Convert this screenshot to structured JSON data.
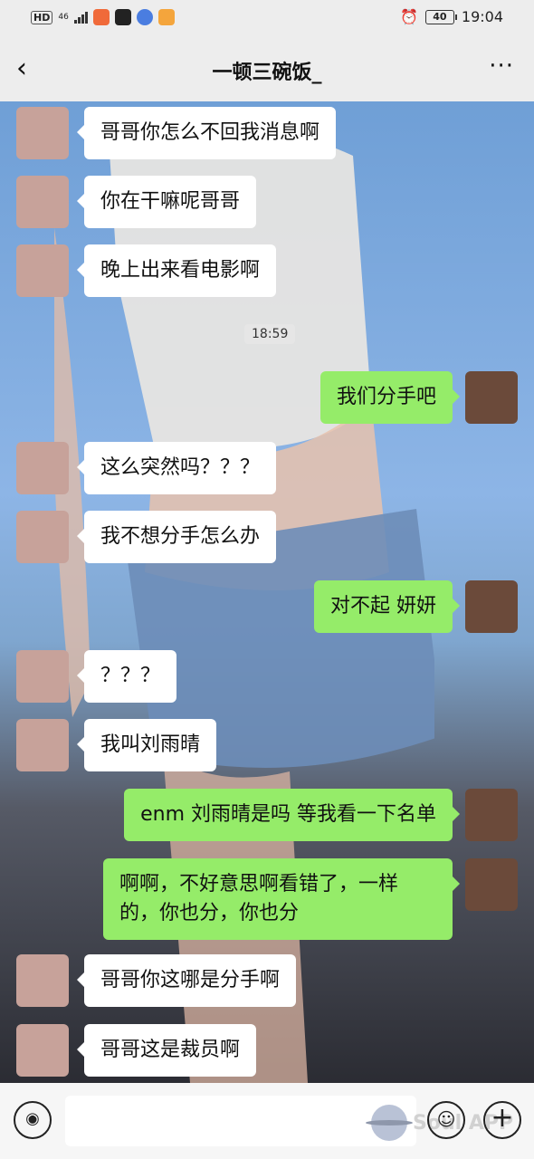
{
  "status_bar": {
    "hd": "HD",
    "network": "46",
    "time": "19:04",
    "battery": "40",
    "icons": [
      "hd-icon",
      "signal-icon",
      "app-badge-icon",
      "soul-app-icon",
      "music-icon",
      "heart-app-icon",
      "alarm-icon",
      "battery-icon"
    ]
  },
  "header": {
    "title": "一顿三碗饭_",
    "back_icon": "‹",
    "more_icon": "···"
  },
  "chat": {
    "messages": [
      {
        "from": "her",
        "text": "哥哥你怎么不回我消息啊"
      },
      {
        "from": "her",
        "text": "你在干嘛呢哥哥"
      },
      {
        "from": "her",
        "text": "晚上出来看电影啊"
      },
      {
        "from": "system",
        "text": "18:59"
      },
      {
        "from": "me",
        "text": "我们分手吧"
      },
      {
        "from": "her",
        "text": "这么突然吗？？？"
      },
      {
        "from": "her",
        "text": "我不想分手怎么办"
      },
      {
        "from": "me",
        "text": "对不起 妍妍"
      },
      {
        "from": "her",
        "text": "？？？"
      },
      {
        "from": "her",
        "text": "我叫刘雨晴"
      },
      {
        "from": "me",
        "text": "enm  刘雨晴是吗 等我看一下名单"
      },
      {
        "from": "me",
        "text": "啊啊，不好意思啊看错了，一样的，你也分，你也分"
      },
      {
        "from": "her",
        "text": "哥哥你这哪是分手啊"
      },
      {
        "from": "her",
        "text": "哥哥这是裁员啊"
      }
    ]
  },
  "input_bar": {
    "voice_icon": "◉",
    "emoji_icon": "☺",
    "plus_icon": "+",
    "watermark": "Soul APP"
  },
  "colors": {
    "background": "#ededed",
    "incoming_bubble": "#ffffff",
    "outgoing_bubble": "#95ec69"
  }
}
